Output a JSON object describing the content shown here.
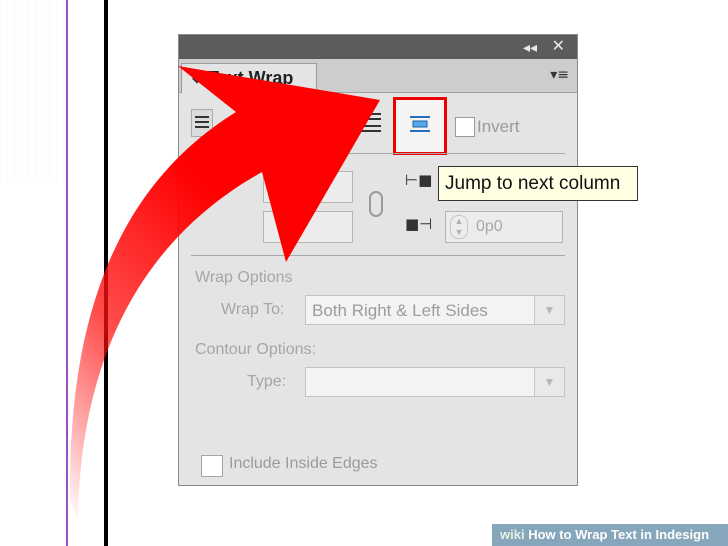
{
  "panel": {
    "title": "Text Wrap",
    "collapse_glyph": "◂◂",
    "close_glyph": "✕",
    "menu_glyph": "▾≡",
    "tab_arrow": "◆"
  },
  "wrap_options": {
    "invert_label": "Invert",
    "invert_checked": false
  },
  "offsets": {
    "bottom_offset_value": "0p0"
  },
  "wrap_to": {
    "section_label": "Wrap Options",
    "label": "Wrap To:",
    "value": "Both Right & Left Sides"
  },
  "contour": {
    "section_label": "Contour Options:",
    "type_label": "Type:",
    "type_value": ""
  },
  "include_inside_edges": {
    "label": "Include Inside Edges",
    "checked": false
  },
  "tooltip": {
    "text": "Jump to next column"
  },
  "watermark": {
    "logo": "wiki",
    "text": "How to Wrap Text in Indesign"
  },
  "colors": {
    "annotation_red": "#ee0000",
    "panel_bg": "#e4e4e4",
    "titlebar": "#5c5c5c",
    "tooltip_bg": "#ffffe4"
  },
  "icons": [
    "collapse-icon",
    "close-icon",
    "panel-menu-icon",
    "wrap-none-icon",
    "jump-object-icon",
    "jump-to-next-column-icon",
    "link-icon",
    "left-offset-icon",
    "right-offset-icon",
    "stepper-icon",
    "dropdown-arrow-icon"
  ]
}
